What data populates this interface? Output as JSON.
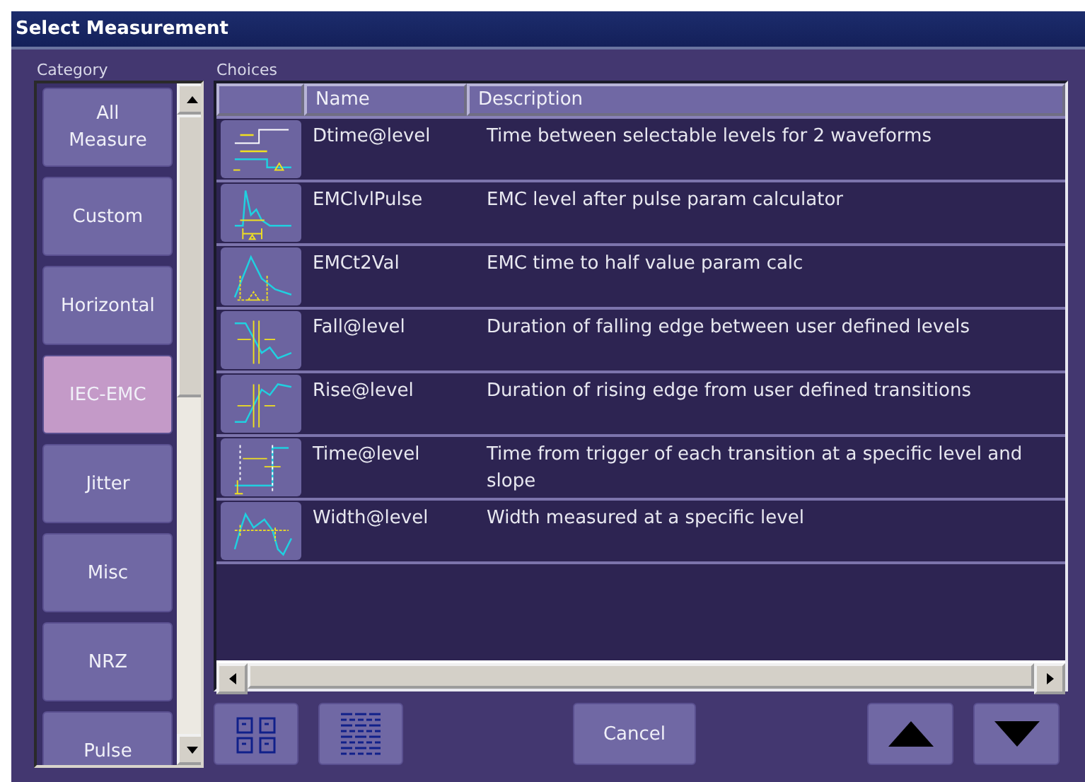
{
  "window": {
    "title": "Select Measurement"
  },
  "category": {
    "label": "Category",
    "items": [
      {
        "label": "All Measure",
        "selected": false
      },
      {
        "label": "Custom",
        "selected": false
      },
      {
        "label": "Horizontal",
        "selected": false
      },
      {
        "label": "IEC-EMC",
        "selected": true
      },
      {
        "label": "Jitter",
        "selected": false
      },
      {
        "label": "Misc",
        "selected": false
      },
      {
        "label": "NRZ",
        "selected": false
      },
      {
        "label": "Pulse",
        "selected": false
      }
    ]
  },
  "choices": {
    "label": "Choices",
    "columns": [
      "Name",
      "Description"
    ],
    "rows": [
      {
        "name": "Dtime@level",
        "description": "Time between selectable levels for 2 waveforms"
      },
      {
        "name": "EMClvlPulse",
        "description": "EMC level after pulse param calculator"
      },
      {
        "name": "EMCt2Val",
        "description": "EMC time to half value param calc"
      },
      {
        "name": "Fall@level",
        "description": "Duration of falling edge between user defined levels"
      },
      {
        "name": "Rise@level",
        "description": "Duration of rising edge from user defined transitions"
      },
      {
        "name": "Time@level",
        "description": "Time from trigger of each transition at a specific level and slope"
      },
      {
        "name": "Width@level",
        "description": "Width measured at a specific level"
      }
    ]
  },
  "buttons": {
    "cancel": "Cancel"
  }
}
